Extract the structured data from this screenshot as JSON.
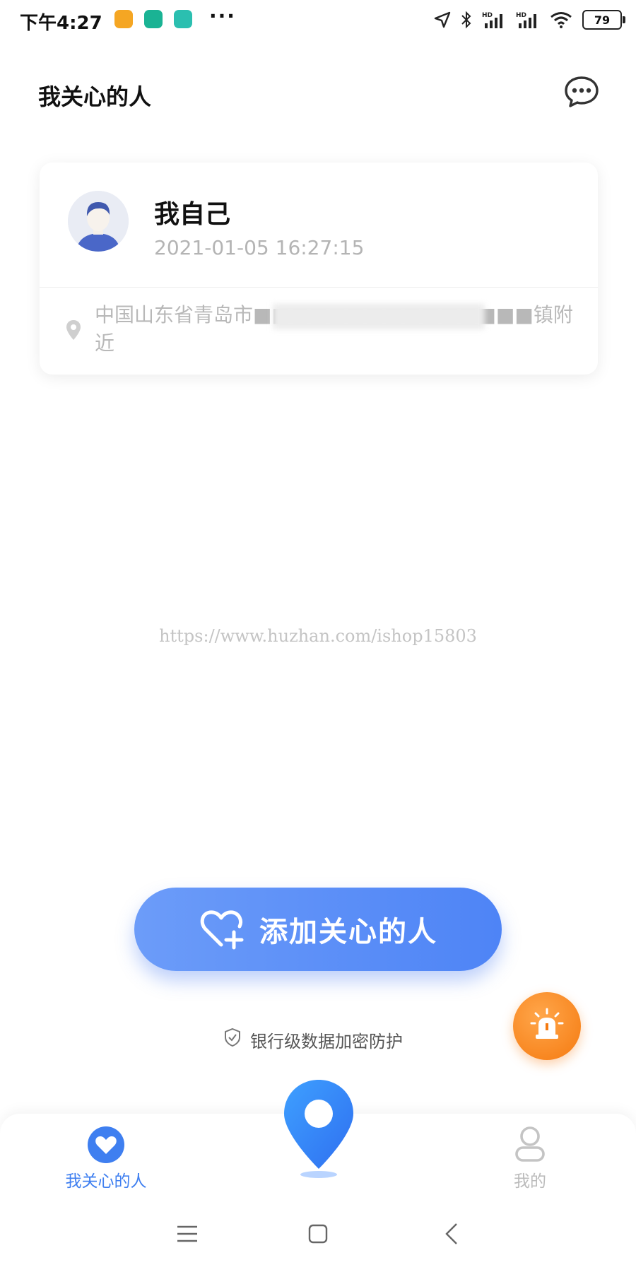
{
  "status_bar": {
    "time": "下午4:27",
    "dots": "···",
    "battery": "79",
    "app_icon_colors": [
      "#f5a623",
      "#1ab394",
      "#2bbfb0"
    ]
  },
  "header": {
    "title": "我关心的人",
    "chat_icon": "message-bubble-icon"
  },
  "card": {
    "name": "我自己",
    "time": "2021-01-05 16:27:15",
    "address": "中国山东省青岛市■■■■■■■■■■■■■■■镇附近"
  },
  "watermark": "https://www.huzhan.com/ishop15803",
  "add_button": {
    "label": "添加关心的人",
    "icon": "heart-plus-icon"
  },
  "secure_text": "银行级数据加密防护",
  "bottom_nav": {
    "items": [
      {
        "label": "我关心的人",
        "icon": "heart-icon",
        "active": true
      },
      {
        "label": "",
        "icon": "location-pin-icon"
      },
      {
        "label": "我的",
        "icon": "user-icon",
        "active": false
      }
    ]
  },
  "colors": {
    "accent": "#3f7ff0",
    "button_gradient": [
      "#6c9cf9",
      "#4e84f6"
    ],
    "sos": "#f57a10"
  }
}
